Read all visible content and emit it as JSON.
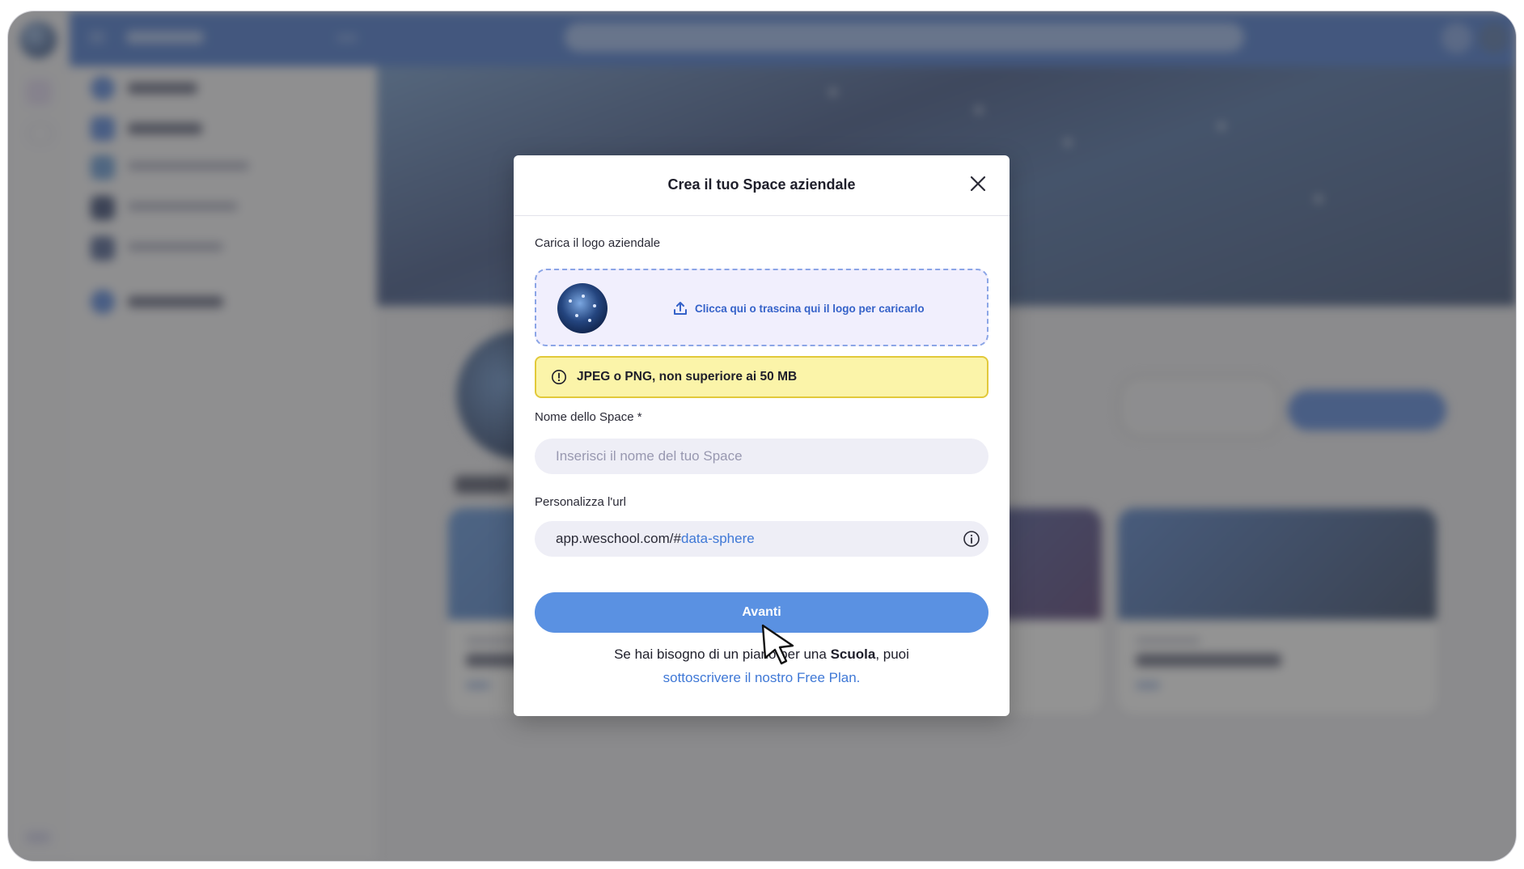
{
  "modal": {
    "title": "Crea il tuo Space aziendale",
    "logo_label": "Carica il logo aziendale",
    "upload_text": "Clicca qui o trascina qui il logo per caricarlo",
    "upload_hint": "JPEG o PNG, non superiore ai 50 MB",
    "name_label": "Nome dello Space *",
    "name_placeholder": "Inserisci il nome del tuo Space",
    "name_value": "",
    "url_label": "Personalizza l'url",
    "url_prefix": "app.weschool.com/#",
    "url_slug": "data-sphere",
    "next_button": "Avanti",
    "footer_text_before": "Se hai bisogno di un piano per una",
    "footer_bold": "Scuola",
    "footer_text_after": ", puoi",
    "footer_link": "sottoscrivere il nostro Free Plan."
  },
  "icons": {
    "close": "close-icon",
    "upload": "upload-icon",
    "warning": "warning-icon",
    "info": "info-icon",
    "cursor": "mouse-pointer-icon"
  },
  "colors": {
    "primary": "#5a91e2",
    "link": "#3f78d6",
    "warning_bg": "#fbf4a9",
    "warning_border": "#e2c93a",
    "dropzone_bg": "#f1effd",
    "topbar": "#2d63c8"
  }
}
